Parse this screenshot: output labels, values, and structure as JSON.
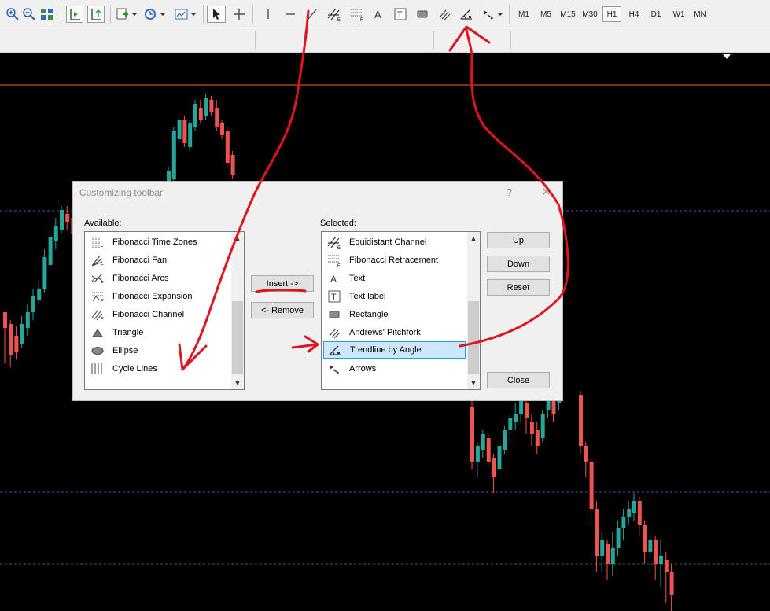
{
  "toolbar": {
    "timeframes": [
      {
        "label": "M1"
      },
      {
        "label": "M5"
      },
      {
        "label": "M15"
      },
      {
        "label": "M30"
      },
      {
        "label": "H1",
        "active": true
      },
      {
        "label": "H4"
      },
      {
        "label": "D1"
      },
      {
        "label": "W1"
      },
      {
        "label": "MN"
      }
    ],
    "icons": [
      "zoom-in-icon",
      "zoom-out-icon",
      "tile-windows-icon",
      "auto-scroll-icon",
      "chart-shift-icon",
      "new-order-icon",
      "periods-icon",
      "templates-icon",
      "cursor-icon",
      "crosshair-icon",
      "vertical-line-icon",
      "horizontal-line-icon",
      "trend-line-icon",
      "equidistant-channel-icon",
      "fibonacci-retracement-icon",
      "text-icon",
      "text-label-icon",
      "rectangle-icon",
      "andrews-pitchfork-icon",
      "trendline-by-angle-icon",
      "arrows-icon"
    ]
  },
  "chart": {
    "up_color": "#26a69a",
    "down_color": "#ef5350",
    "level_line_color": "#f0642a",
    "dashed_line_color": "#3a57b5",
    "green_line_color": "#2f6b2f"
  },
  "dialog": {
    "title": "Customizing toolbar",
    "help": "?",
    "close_glyph": "✕",
    "available_label": "Available:",
    "selected_label": "Selected:",
    "available_items": [
      {
        "label": "Fibonacci Time Zones",
        "icon": "fibonacci-time-zones-icon"
      },
      {
        "label": "Fibonacci Fan",
        "icon": "fibonacci-fan-icon"
      },
      {
        "label": "Fibonacci Arcs",
        "icon": "fibonacci-arcs-icon"
      },
      {
        "label": "Fibonacci Expansion",
        "icon": "fibonacci-expansion-icon"
      },
      {
        "label": "Fibonacci Channel",
        "icon": "fibonacci-channel-icon"
      },
      {
        "label": "Triangle",
        "icon": "triangle-icon"
      },
      {
        "label": "Ellipse",
        "icon": "ellipse-icon"
      },
      {
        "label": "Cycle Lines",
        "icon": "cycle-lines-icon"
      }
    ],
    "selected_items": [
      {
        "label": "Equidistant Channel",
        "icon": "equidistant-channel-icon"
      },
      {
        "label": "Fibonacci Retracement",
        "icon": "fibonacci-retracement-icon"
      },
      {
        "label": "Text",
        "icon": "text-icon"
      },
      {
        "label": "Text label",
        "icon": "text-label-icon"
      },
      {
        "label": "Rectangle",
        "icon": "rectangle-icon"
      },
      {
        "label": "Andrews' Pitchfork",
        "icon": "andrews-pitchfork-icon"
      },
      {
        "label": "Trendline by Angle",
        "icon": "trendline-by-angle-icon",
        "selected": true
      },
      {
        "label": "Arrows",
        "icon": "arrows-icon"
      }
    ],
    "buttons": {
      "insert": "Insert ->",
      "remove": "<- Remove",
      "up": "Up",
      "down": "Down",
      "reset": "Reset",
      "close": "Close"
    }
  },
  "annotation_color": "#e0141e"
}
